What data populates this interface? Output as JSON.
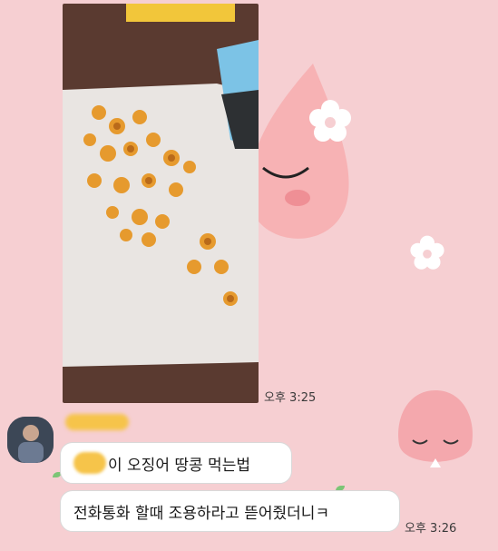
{
  "chat": {
    "photo_time": "오후 3:25",
    "messages": [
      {
        "text": "이 오징어 땅콩 먹는법"
      },
      {
        "text": "전화통화 할때 조용하라고 뜯어줬더니ㅋ",
        "time": "오후 3:26"
      }
    ]
  },
  "colors": {
    "background": "#f6cfd2",
    "bubble": "#ffffff",
    "name_highlight": "#f6c44a"
  }
}
